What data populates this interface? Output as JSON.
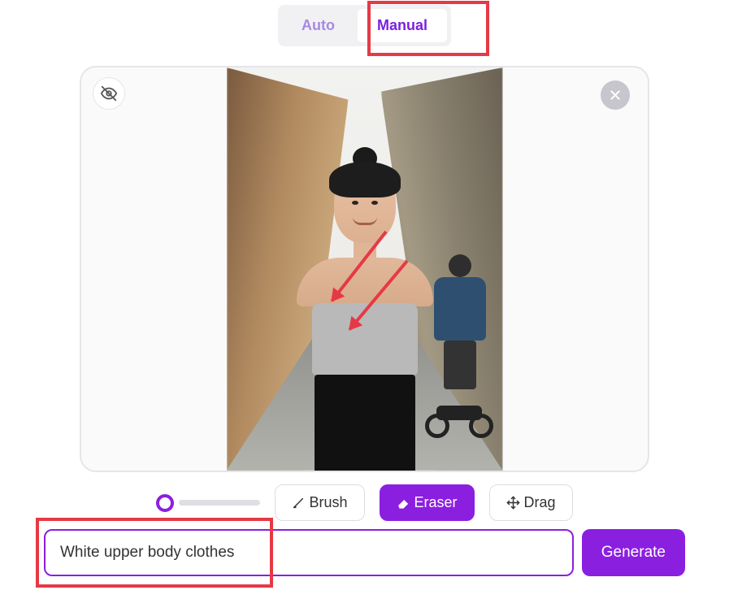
{
  "tabs": {
    "auto": "Auto",
    "manual": "Manual"
  },
  "tools": {
    "brush": "Brush",
    "eraser": "Eraser",
    "drag": "Drag"
  },
  "prompt": {
    "value": "White upper body clothes"
  },
  "actions": {
    "generate": "Generate"
  }
}
